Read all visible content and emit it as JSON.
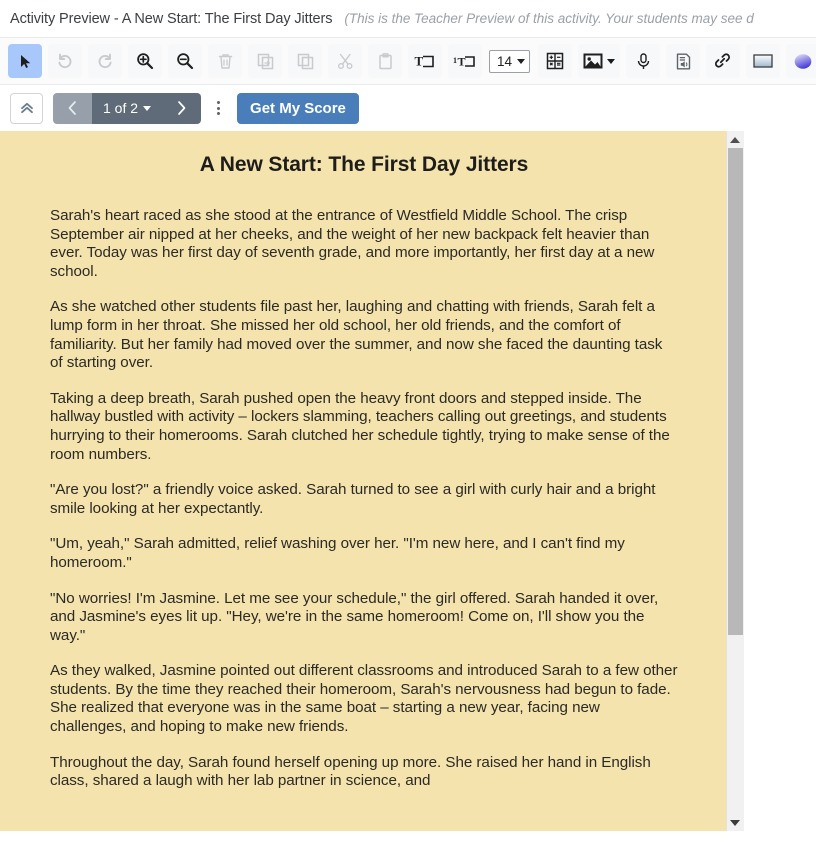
{
  "titlebar": {
    "title": "Activity Preview - A New Start: The First Day Jitters",
    "note": "(This is the Teacher Preview of this activity. Your students may see d"
  },
  "toolbar": {
    "items": [
      {
        "name": "select-tool",
        "label": "Select",
        "icon": "cursor-arrow-icon",
        "state": "active"
      },
      {
        "name": "undo",
        "label": "Undo",
        "icon": "undo-icon",
        "state": "disabled"
      },
      {
        "name": "redo",
        "label": "Redo",
        "icon": "redo-icon",
        "state": "disabled"
      },
      {
        "name": "zoom-in",
        "label": "Zoom In",
        "icon": "zoom-in-icon",
        "state": "enabled"
      },
      {
        "name": "zoom-out",
        "label": "Zoom Out",
        "icon": "zoom-out-icon",
        "state": "enabled"
      },
      {
        "name": "delete",
        "label": "Delete",
        "icon": "trash-icon",
        "state": "disabled"
      },
      {
        "name": "duplicate",
        "label": "Duplicate",
        "icon": "duplicate-icon",
        "state": "disabled"
      },
      {
        "name": "copy",
        "label": "Copy",
        "icon": "copy-icon",
        "state": "disabled"
      },
      {
        "name": "cut",
        "label": "Cut",
        "icon": "scissors-icon",
        "state": "disabled"
      },
      {
        "name": "paste",
        "label": "Paste",
        "icon": "clipboard-icon",
        "state": "disabled"
      },
      {
        "name": "text-box",
        "label": "Text Box",
        "icon": "text-box-icon",
        "state": "enabled"
      },
      {
        "name": "text-line",
        "label": "Single Line Text",
        "icon": "text-line-icon",
        "state": "enabled"
      }
    ],
    "font_size": "14",
    "after_items": [
      {
        "name": "equation",
        "label": "Equation",
        "icon": "math-grid-icon",
        "state": "enabled"
      },
      {
        "name": "image",
        "label": "Image",
        "icon": "image-icon",
        "state": "enabled",
        "dropdown": true
      },
      {
        "name": "audio-record",
        "label": "Record Audio",
        "icon": "microphone-icon",
        "state": "enabled"
      },
      {
        "name": "text-to-speech",
        "label": "Text To Speech",
        "icon": "speaker-doc-icon",
        "state": "enabled"
      },
      {
        "name": "link",
        "label": "Link",
        "icon": "link-icon",
        "state": "enabled"
      },
      {
        "name": "rectangle",
        "label": "Rectangle",
        "icon": "rectangle-shape-icon",
        "state": "enabled"
      },
      {
        "name": "ellipse",
        "label": "Ellipse",
        "icon": "ellipse-shape-icon",
        "state": "enabled"
      }
    ]
  },
  "navbar": {
    "collapse_icon": "chevron-double-up-icon",
    "prev_icon": "chevron-left-icon",
    "next_icon": "chevron-right-icon",
    "page_label": "1 of 2",
    "current_page": 1,
    "total_pages": 2,
    "more_icon": "kebab-menu-icon",
    "score_button": "Get My Score",
    "score_button_color": "#4a7ebb",
    "pager_color": "#5f6b78"
  },
  "document": {
    "background_color": "#f5e3ad",
    "title": "A New Start: The First Day Jitters",
    "paragraphs": [
      "Sarah's heart raced as she stood at the entrance of Westfield Middle School. The crisp September air nipped at her cheeks, and the weight of her new backpack felt heavier than ever. Today was her first day of seventh grade, and more importantly, her first day at a new school.",
      "As she watched other students file past her, laughing and chatting with friends, Sarah felt a lump form in her throat. She missed her old school, her old friends, and the comfort of familiarity. But her family had moved over the summer, and now she faced the daunting task of starting over.",
      "Taking a deep breath, Sarah pushed open the heavy front doors and stepped inside. The hallway bustled with activity – lockers slamming, teachers calling out greetings, and students hurrying to their homerooms. Sarah clutched her schedule tightly, trying to make sense of the room numbers.",
      "\"Are you lost?\" a friendly voice asked. Sarah turned to see a girl with curly hair and a bright smile looking at her expectantly.",
      "\"Um, yeah,\" Sarah admitted, relief washing over her. \"I'm new here, and I can't find my homeroom.\"",
      "\"No worries! I'm Jasmine. Let me see your schedule,\" the girl offered. Sarah handed it over, and Jasmine's eyes lit up. \"Hey, we're in the same homeroom! Come on, I'll show you the way.\"",
      "As they walked, Jasmine pointed out different classrooms and introduced Sarah to a few other students. By the time they reached their homeroom, Sarah's nervousness had begun to fade. She realized that everyone was in the same boat – starting a new year, facing new challenges, and hoping to make new friends.",
      "Throughout the day, Sarah found herself opening up more. She raised her hand in English class, shared a laugh with her lab partner in science, and"
    ]
  },
  "scrollbar": {
    "up_icon": "triangle-up-icon",
    "down_icon": "triangle-down-icon"
  }
}
